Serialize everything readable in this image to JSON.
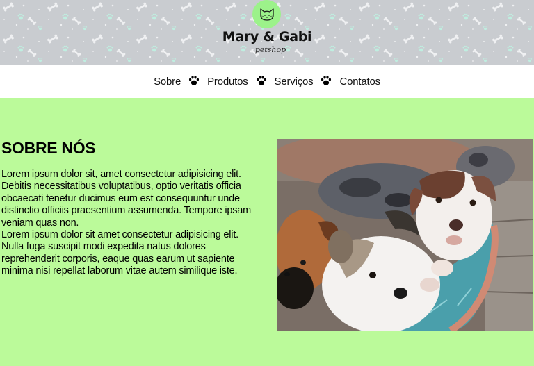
{
  "header": {
    "brand_name": "Mary & Gabi",
    "tagline": "petshop",
    "logo_icon": "cat-icon",
    "pattern_icon": "bone-paw-pattern"
  },
  "nav": {
    "items": [
      {
        "label": "Sobre"
      },
      {
        "label": "Produtos"
      },
      {
        "label": "Serviços"
      },
      {
        "label": "Contatos"
      }
    ],
    "separator_icon": "paw-icon"
  },
  "about": {
    "title": "SOBRE NÓS",
    "paragraphs": [
      "Lorem ipsum dolor sit, amet consectetur adipisicing elit. Debitis necessitatibus voluptatibus, optio veritatis officia obcaecati tenetur ducimus eum est consequuntur unde distinctio officiis praesentium assumenda. Tempore ipsam veniam quas non.",
      "Lorem ipsum dolor sit amet consectetur adipisicing elit. Nulla fuga suscipit modi expedita natus dolores reprehenderit corporis, eaque quas earum ut sapiente minima nisi repellat laborum vitae autem similique iste."
    ],
    "image_icon": "puppies-photo"
  },
  "colors": {
    "page_background": "#bbfa9a",
    "header_background": "#c9ccd0",
    "logo_badge": "#9cf28a",
    "nav_background": "#ffffff",
    "text": "#000000"
  }
}
